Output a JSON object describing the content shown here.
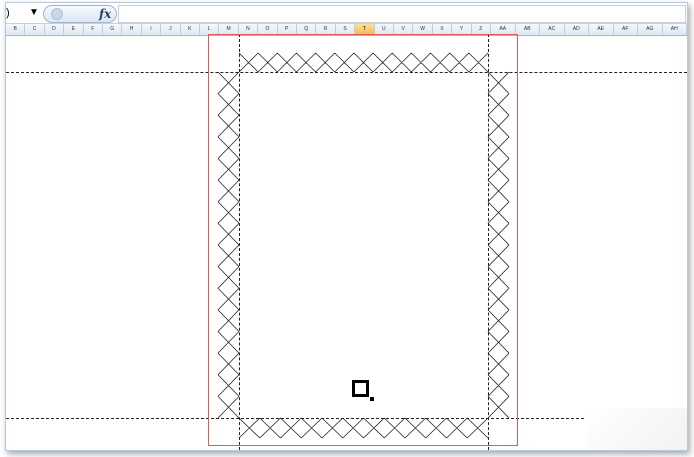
{
  "formula_bar": {
    "name_box_value": ")",
    "name_box_dropdown_glyph": "▼",
    "fx_label": "fx",
    "formula_value": ""
  },
  "column_headers": [
    "B",
    "C",
    "D",
    "E",
    "F",
    "G",
    "H",
    "I",
    "J",
    "K",
    "L",
    "M",
    "N",
    "O",
    "P",
    "Q",
    "R",
    "S",
    "T",
    "U",
    "V",
    "W",
    "X",
    "Y",
    "Z",
    "AA",
    "AB",
    "AC",
    "AD",
    "AE",
    "AF",
    "AG",
    "AH"
  ],
  "selected_column": "T",
  "colors": {
    "selected_column_header": "#f5b94c",
    "print_area_border": "#e05a5a",
    "page_break_lines": "#222222",
    "pattern_stroke": "#222222"
  },
  "sheet": {
    "border_pattern": "diamond-lattice",
    "active_cell_value": ""
  }
}
